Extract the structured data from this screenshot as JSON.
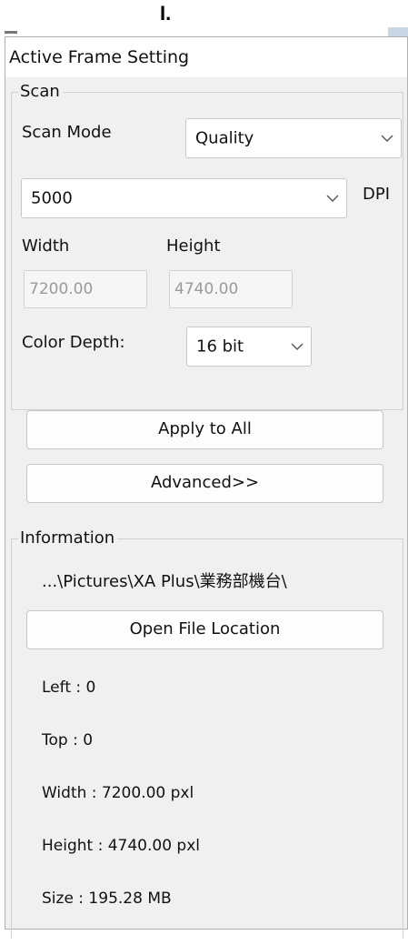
{
  "top_mark": "I.",
  "panel": {
    "title": "Active Frame Setting"
  },
  "scan": {
    "group_label": "Scan",
    "scan_mode_label": "Scan Mode",
    "scan_mode_value": "Quality",
    "dpi_value": "5000",
    "dpi_label": "DPI",
    "width_label": "Width",
    "height_label": "Height",
    "width_value": "7200.00",
    "height_value": "4740.00",
    "color_depth_label": "Color Depth:",
    "color_depth_value": "16 bit"
  },
  "buttons": {
    "apply_to_all": "Apply to All",
    "advanced": "Advanced>>",
    "open_file_location": "Open File Location"
  },
  "information": {
    "group_label": "Information",
    "path": "...\\Pictures\\XA Plus\\業務部機台\\",
    "left": "Left : 0",
    "top": "Top : 0",
    "width": "Width : 7200.00 pxl",
    "height": "Height : 4740.00 pxl",
    "size": "Size : 195.28 MB"
  }
}
